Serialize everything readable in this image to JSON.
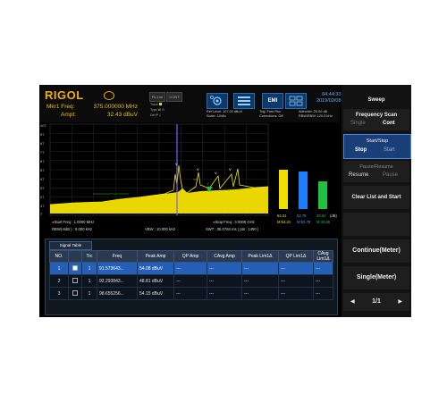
{
  "header": {
    "logo": "RIGOL",
    "marker_label": "Mkr1 Freq:",
    "marker_freq": "375.000000 MHz",
    "amp_label": "Ampt:",
    "amp_value": "32.43 dBuV",
    "btn_peak": "Pk-Lim",
    "btn_cont": "CONT",
    "trace_row1": "Trace",
    "trace_row2": "Type",
    "trace_row3": "Det",
    "ref_level": "Ref Level: 107.00 dBuV",
    "scale": "Scale: 10/div",
    "trig": "Trig: Free Run",
    "corrections": "Corrections: Off",
    "atten": "Atten/div: 20.00 dB",
    "rbw_hdr": "RBW/RBW: 120.0 kHz",
    "emi": "EMI",
    "time": "04:44:33",
    "date": "2019/02/08"
  },
  "plot": {
    "y_ticks": [
      "107",
      "97",
      "87",
      "77",
      "67",
      "57",
      "47",
      "37",
      "27",
      "17",
      "7"
    ],
    "y_unit": "dBuV",
    "bar_values": [
      "54.21",
      "52.78",
      "40.53"
    ],
    "bar_bottom_labels": [
      "M:54.21",
      "M:52.78",
      "M:40.65"
    ],
    "bar_unit": "(dB)",
    "bar_colors": [
      "#f0e000",
      "#1e7cff",
      "#20c040"
    ]
  },
  "footer": {
    "start_freq": "Start Freq : 1.0000 MHz",
    "stop_freq": "Stop Freq : 3.0000 GHz",
    "rbw": "RBW(-6dB ) : 9.000 kHz",
    "vbw": "VBW : 10.000 kHz",
    "swt": "SWT : 35.0784 ms ( pts : 1490 )"
  },
  "signal_table": {
    "tab": "Signal Table",
    "columns": [
      "NO.",
      "",
      "Trc",
      "Freq",
      "Peak Amp",
      "QP Amp",
      "CAvg Amp",
      "Peak Lim1Δ",
      "QP Lim1Δ",
      "CAvg Lim1Δ"
    ],
    "rows": [
      {
        "no": "1",
        "trc": "1",
        "freq": "91.573643...",
        "peak": "54.08 dBuV",
        "qp": "---",
        "cavg": "---",
        "pk_lim": "---",
        "qp_lim": "---",
        "cavg_lim": "---"
      },
      {
        "no": "2",
        "trc": "1",
        "freq": "92.293843...",
        "peak": "48.81 dBuV",
        "qp": "---",
        "cavg": "---",
        "pk_lim": "---",
        "qp_lim": "---",
        "cavg_lim": "---"
      },
      {
        "no": "3",
        "trc": "1",
        "freq": "98.655256...",
        "peak": "54.15 dBuV",
        "qp": "---",
        "cavg": "---",
        "pk_lim": "---",
        "qp_lim": "---",
        "cavg_lim": "---"
      }
    ]
  },
  "menu": {
    "title": "Sweep",
    "freq_scan": "Frequency Scan",
    "single": "Single",
    "cont": "Cont",
    "start_stop": "Start/Stop",
    "stop": "Stop",
    "start": "Start",
    "pause_resume": "Pause/Resume",
    "resume": "Resume",
    "pause": "Pause",
    "clear_list": "Clear List and Start",
    "continue_meter": "Continue(Meter)",
    "single_meter": "Single(Meter)",
    "page": "1/1"
  }
}
